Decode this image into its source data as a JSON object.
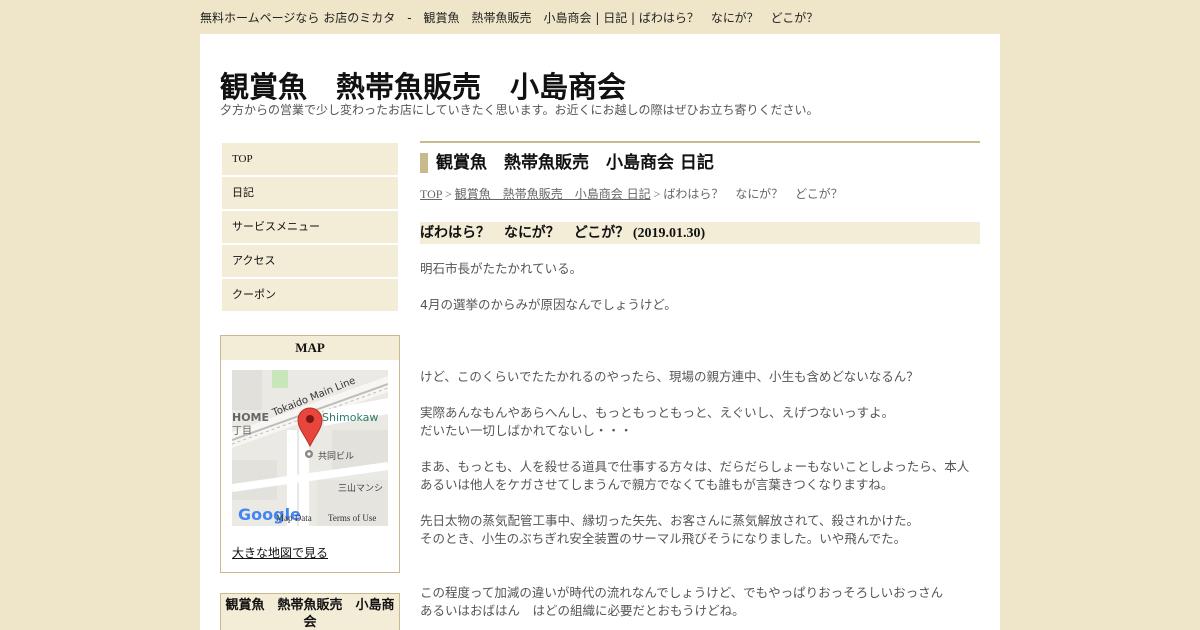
{
  "topbar": {
    "text": "無料ホームページなら お店のミカタ　-　観賞魚　熱帯魚販売　小島商会 | 日記 | ばわはら？　なにが？　どこが？"
  },
  "site": {
    "title": "観賞魚　熱帯魚販売　小島商会",
    "subtitle": "夕方からの営業で少し変わったお店にしていきたく思います。お近くにお越しの際はぜひお立ち寄りください。"
  },
  "nav": {
    "items": [
      "TOP",
      "日記",
      "サービスメニュー",
      "アクセス",
      "クーポン"
    ]
  },
  "map": {
    "heading": "MAP",
    "labels": {
      "line": "Tokaido Main Line",
      "area": "Shimokaw",
      "home": "HOME",
      "chome": "丁目",
      "building1": "共同ビル",
      "building2": "三山マンシ",
      "google": "Google",
      "data": "Map Data",
      "terms": "Terms of Use"
    },
    "link": "大きな地図で見る"
  },
  "shop_box": {
    "heading": "観賞魚　熱帯魚販売　小島商会"
  },
  "main": {
    "title": "観賞魚　熱帯魚販売　小島商会 日記",
    "breadcrumb": {
      "top": "TOP",
      "sep1": " > ",
      "diary": "観賞魚　熱帯魚販売　小島商会 日記",
      "sep2": " > ",
      "current": "ばわはら？　なにが？　どこが？"
    },
    "post": {
      "title": "ばわはら？　なにが？　どこが？",
      "date": "(2019.01.30)",
      "p1": "明石市長がたたかれている。",
      "p2": "4月の選挙のからみが原因なんでしょうけど。",
      "p3": "けど、このくらいでたたかれるのやったら、現場の親方連中、小生も含めどないなるん？",
      "p4a": "実際あんなもんやあらへんし、もっともっともっと、えぐいし、えげつないっすよ。",
      "p4b": "だいたい一切しばかれてないし・・・",
      "p5": "まあ、もっとも、人を殺せる道具で仕事する方々は、だらだらしょーもないことしよったら、本人あるいは他人をケガさせてしまうんで親方でなくても誰もが言葉きつくなりますね。",
      "p6a": "先日太物の蒸気配管工事中、縁切った矢先、お客さんに蒸気解放されて、殺されかけた。",
      "p6b": "そのとき、小生のぶちぎれ安全装置のサーマル飛びそうになりました。いや飛んでた。",
      "p7a": "この程度って加減の違いが時代の流れなんでしょうけど、でもやっぱりおっそろしいおっさん",
      "p7b": "あるいはおばはん　はどの組織に必要だとおもうけどね。"
    }
  },
  "colors": {
    "page_bg": "#efe6c9",
    "accent": "#c8b98e",
    "tint": "#f3ecd7"
  }
}
